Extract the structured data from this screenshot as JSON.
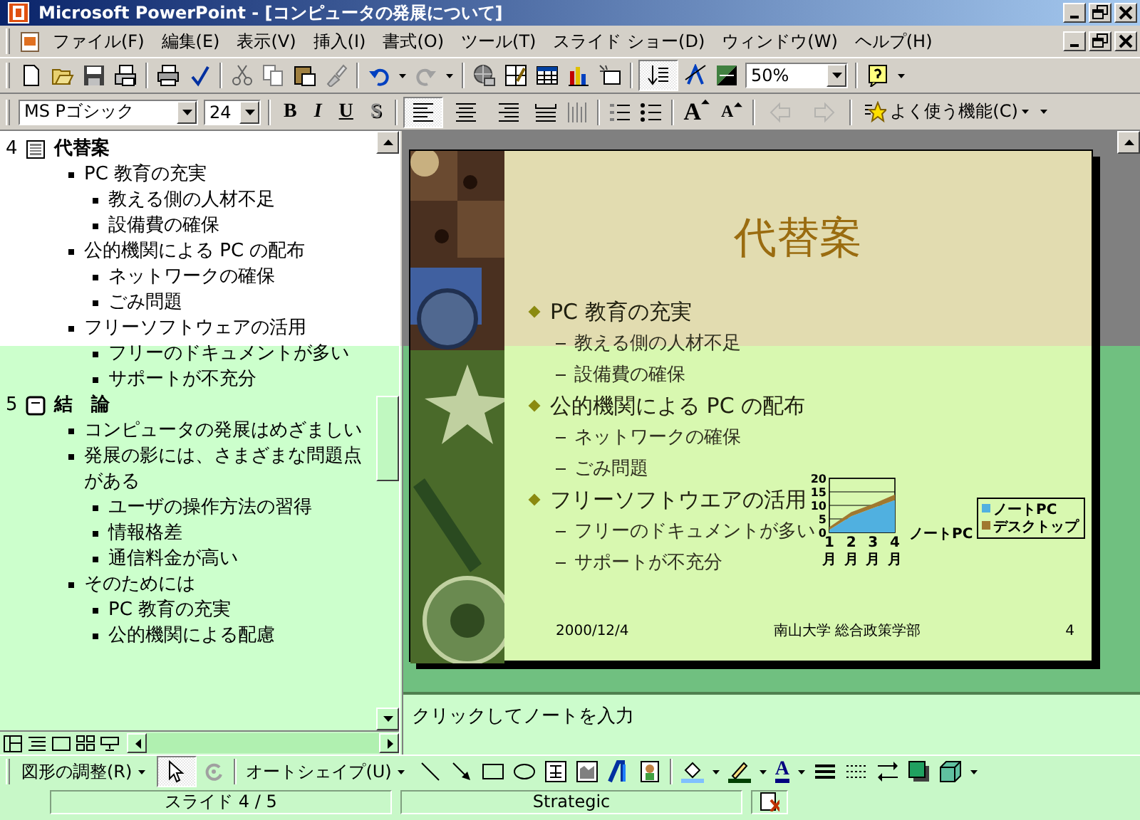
{
  "window": {
    "title": "Microsoft PowerPoint - [コンピュータの発展について]"
  },
  "menu_bar": {
    "items": [
      "ファイル(F)",
      "編集(E)",
      "表示(V)",
      "挿入(I)",
      "書式(O)",
      "ツール(T)",
      "スライド ショー(D)",
      "ウィンドウ(W)",
      "ヘルプ(H)"
    ]
  },
  "standard_toolbar": {
    "expand_all": {
      "on": true
    },
    "zoom": "50%"
  },
  "formatting_toolbar": {
    "font": "MS Pゴシック",
    "size": "24",
    "style_buttons": [
      {
        "label": "B",
        "kind": "bold"
      },
      {
        "label": "I",
        "kind": "italic"
      },
      {
        "label": "U",
        "kind": "underline"
      },
      {
        "label": "S",
        "kind": "shadow"
      }
    ],
    "alignment": [
      {
        "kind": "left",
        "selected": true
      },
      {
        "kind": "center",
        "selected": false
      },
      {
        "kind": "right",
        "selected": false
      }
    ],
    "font_size_buttons": [
      {
        "label": "A",
        "kind": "grow"
      },
      {
        "label": "A",
        "kind": "shrink"
      }
    ],
    "outline_buttons": [
      {
        "kind": "promote",
        "disabled": true
      },
      {
        "kind": "demote",
        "disabled": true
      }
    ],
    "common_tasks": "よく使う機能(C)"
  },
  "outline": {
    "slides": [
      {
        "number": "4",
        "title": "代替案",
        "kind": "graphic",
        "children": [
          {
            "text": "PC 教育の充実",
            "children": [
              {
                "text": "教える側の人材不足"
              },
              {
                "text": "設備費の確保"
              }
            ]
          },
          {
            "text": "公的機関による PC の配布",
            "children": [
              {
                "text": "ネットワークの確保"
              },
              {
                "text": "ごみ問題"
              }
            ]
          },
          {
            "text": "フリーソフトウェアの活用",
            "children": [
              {
                "text": "フリーのドキュメントが多い"
              },
              {
                "text": "サポートが不充分"
              }
            ]
          }
        ]
      },
      {
        "number": "5",
        "title": "結　論",
        "kind": "text",
        "children": [
          {
            "text": "コンピュータの発展はめざましい"
          },
          {
            "text": "発展の影には、さまざまな問題点がある",
            "children": [
              {
                "text": "ユーザの操作方法の習得"
              },
              {
                "text": "情報格差"
              },
              {
                "text": "通信料金が高い"
              }
            ]
          },
          {
            "text": "そのためには",
            "children": [
              {
                "text": "PC 教育の充実"
              },
              {
                "text": "公的機関による配慮"
              }
            ]
          }
        ]
      }
    ]
  },
  "slide": {
    "title": "代替案",
    "bullets": [
      {
        "text": "PC 教育の充実",
        "children": [
          {
            "text": "教える側の人材不足"
          },
          {
            "text": "設備費の確保"
          }
        ]
      },
      {
        "text": "公的機関による PC の配布",
        "children": [
          {
            "text": "ネットワークの確保"
          },
          {
            "text": "ごみ問題"
          }
        ]
      },
      {
        "text": "フリーソフトウエアの活用",
        "children": [
          {
            "text": "フリーのドキュメントが多い"
          },
          {
            "text": "サポートが不充分"
          }
        ]
      }
    ],
    "chart_data": {
      "type": "area",
      "stacked": true,
      "categories": [
        "1月",
        "2月",
        "3月",
        "4月"
      ],
      "ylim": [
        0,
        20
      ],
      "yticks": [
        {
          "value": 0,
          "label": "0"
        },
        {
          "value": 5,
          "label": "5"
        },
        {
          "value": 10,
          "label": "10"
        },
        {
          "value": 15,
          "label": "15"
        },
        {
          "value": 20,
          "label": "20"
        }
      ],
      "series": [
        {
          "name": "ノートPC",
          "color": "#50b0e0",
          "values": [
            1,
            6,
            9,
            12
          ]
        },
        {
          "name": "デスクトップ",
          "color": "#a07830",
          "values": [
            1,
            1.5,
            1.5,
            2
          ]
        }
      ],
      "legend": "right",
      "grid": true,
      "annotations": [
        {
          "text": "ノートPC"
        }
      ]
    },
    "footer": {
      "date": "2000/12/4",
      "center": "南山大学 総合政策学部",
      "number": "4"
    }
  },
  "notes": {
    "placeholder": "クリックしてノートを入力"
  },
  "drawing_toolbar": {
    "draw_menu": "図形の調整(R)",
    "autoshapes": "オートシェイプ(U)",
    "font_color": "A"
  },
  "status_bar": {
    "slide": "スライド 4 / 5",
    "design": "Strategic"
  }
}
